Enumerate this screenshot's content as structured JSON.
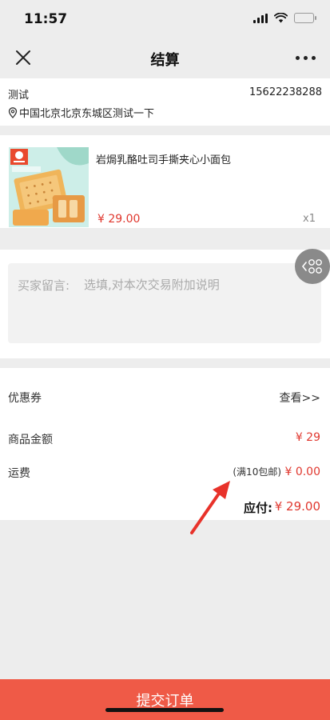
{
  "status_bar": {
    "time": "11:57"
  },
  "nav": {
    "title": "结算"
  },
  "address": {
    "name": "测试",
    "phone": "15622238288",
    "detail": "中国北京北京东城区测试一下"
  },
  "product": {
    "name": "岩焗乳酪吐司手撕夹心小面包",
    "price": "¥ 29.00",
    "quantity": "x1",
    "image_brand": "良品铺子"
  },
  "note": {
    "label": "买家留言:",
    "placeholder": "选填,对本次交易附加说明"
  },
  "summary": {
    "coupon_label": "优惠券",
    "coupon_link": "查看>>",
    "goods_amount_label": "商品金额",
    "goods_amount_value": "¥ 29",
    "shipping_label": "运费",
    "shipping_note": "(满10包邮)",
    "shipping_value": "¥ 0.00",
    "total_label": "应付:",
    "total_value": "¥ 29.00"
  },
  "submit": {
    "label": "提交订单"
  },
  "colors": {
    "accent_red": "#e0372e",
    "submit_bg": "#ef5a47",
    "page_bg": "#ededed"
  }
}
